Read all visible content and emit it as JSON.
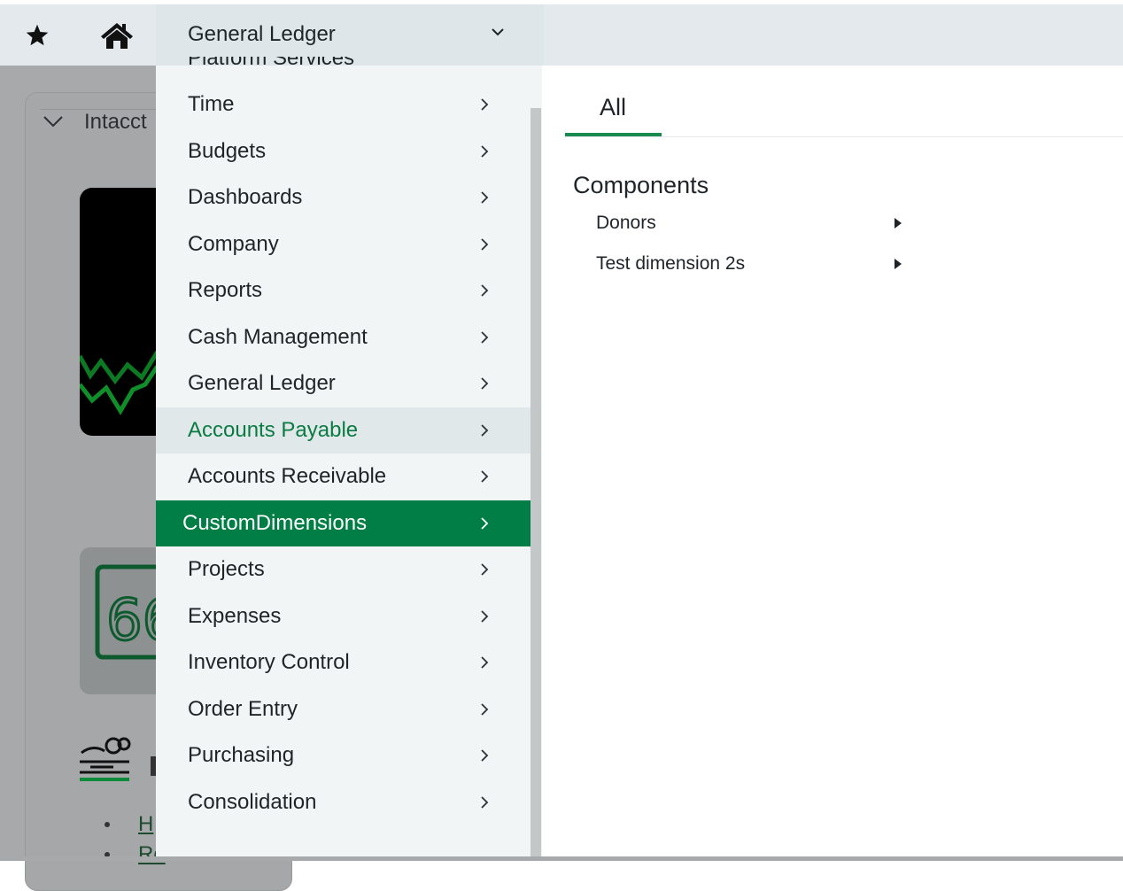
{
  "topbar": {
    "favorites_icon": "star-icon",
    "home_icon": "home-icon",
    "module_selector": {
      "label": "General Ledger",
      "icon": "chevron-down-icon"
    }
  },
  "background_page": {
    "card_title": "Intacct",
    "list_links": [
      "H",
      "Re"
    ]
  },
  "menu": {
    "partial_item": "Platform Services",
    "items": [
      {
        "label": "Time"
      },
      {
        "label": "Budgets"
      },
      {
        "label": "Dashboards"
      },
      {
        "label": "Company"
      },
      {
        "label": "Reports"
      },
      {
        "label": "Cash Management"
      },
      {
        "label": "General Ledger"
      },
      {
        "label": "Accounts Payable",
        "state": "hover"
      },
      {
        "label": "Accounts Receivable"
      },
      {
        "label": "CustomDimensions",
        "state": "active"
      },
      {
        "label": "Projects"
      },
      {
        "label": "Expenses"
      },
      {
        "label": "Inventory Control"
      },
      {
        "label": "Order Entry"
      },
      {
        "label": "Purchasing"
      },
      {
        "label": "Consolidation"
      }
    ]
  },
  "content": {
    "tabs": [
      {
        "label": "All",
        "selected": true
      }
    ],
    "section_title": "Components",
    "components": [
      {
        "label": "Donors"
      },
      {
        "label": "Test dimension 2s"
      }
    ]
  },
  "colors": {
    "brand_green": "#007e45",
    "hover_text_green": "#0a7c43",
    "topbar_bg": "#e3e9ec",
    "overlay_gray": "#a7a9aa"
  }
}
